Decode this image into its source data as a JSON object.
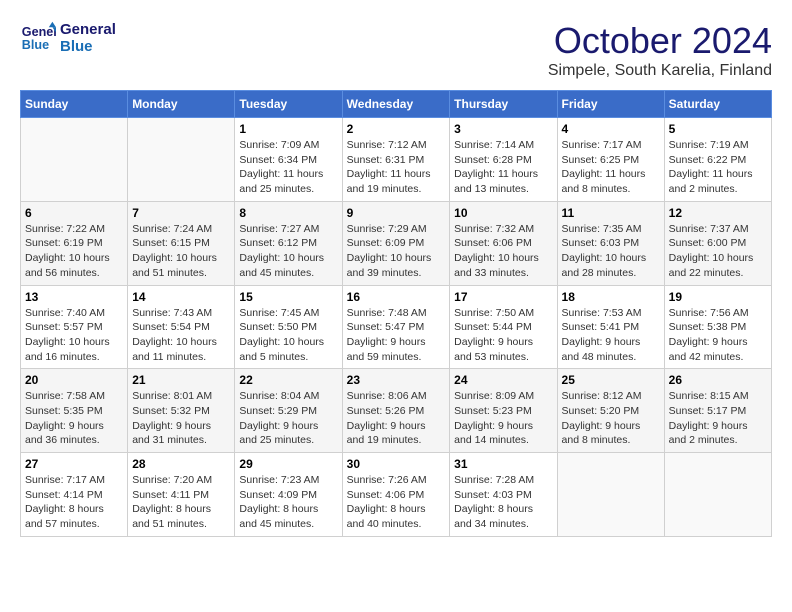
{
  "header": {
    "logo_line1": "General",
    "logo_line2": "Blue",
    "month_title": "October 2024",
    "location": "Simpele, South Karelia, Finland"
  },
  "weekdays": [
    "Sunday",
    "Monday",
    "Tuesday",
    "Wednesday",
    "Thursday",
    "Friday",
    "Saturday"
  ],
  "weeks": [
    [
      {
        "day": "",
        "sunrise": "",
        "sunset": "",
        "daylight": ""
      },
      {
        "day": "",
        "sunrise": "",
        "sunset": "",
        "daylight": ""
      },
      {
        "day": "1",
        "sunrise": "Sunrise: 7:09 AM",
        "sunset": "Sunset: 6:34 PM",
        "daylight": "Daylight: 11 hours and 25 minutes."
      },
      {
        "day": "2",
        "sunrise": "Sunrise: 7:12 AM",
        "sunset": "Sunset: 6:31 PM",
        "daylight": "Daylight: 11 hours and 19 minutes."
      },
      {
        "day": "3",
        "sunrise": "Sunrise: 7:14 AM",
        "sunset": "Sunset: 6:28 PM",
        "daylight": "Daylight: 11 hours and 13 minutes."
      },
      {
        "day": "4",
        "sunrise": "Sunrise: 7:17 AM",
        "sunset": "Sunset: 6:25 PM",
        "daylight": "Daylight: 11 hours and 8 minutes."
      },
      {
        "day": "5",
        "sunrise": "Sunrise: 7:19 AM",
        "sunset": "Sunset: 6:22 PM",
        "daylight": "Daylight: 11 hours and 2 minutes."
      }
    ],
    [
      {
        "day": "6",
        "sunrise": "Sunrise: 7:22 AM",
        "sunset": "Sunset: 6:19 PM",
        "daylight": "Daylight: 10 hours and 56 minutes."
      },
      {
        "day": "7",
        "sunrise": "Sunrise: 7:24 AM",
        "sunset": "Sunset: 6:15 PM",
        "daylight": "Daylight: 10 hours and 51 minutes."
      },
      {
        "day": "8",
        "sunrise": "Sunrise: 7:27 AM",
        "sunset": "Sunset: 6:12 PM",
        "daylight": "Daylight: 10 hours and 45 minutes."
      },
      {
        "day": "9",
        "sunrise": "Sunrise: 7:29 AM",
        "sunset": "Sunset: 6:09 PM",
        "daylight": "Daylight: 10 hours and 39 minutes."
      },
      {
        "day": "10",
        "sunrise": "Sunrise: 7:32 AM",
        "sunset": "Sunset: 6:06 PM",
        "daylight": "Daylight: 10 hours and 33 minutes."
      },
      {
        "day": "11",
        "sunrise": "Sunrise: 7:35 AM",
        "sunset": "Sunset: 6:03 PM",
        "daylight": "Daylight: 10 hours and 28 minutes."
      },
      {
        "day": "12",
        "sunrise": "Sunrise: 7:37 AM",
        "sunset": "Sunset: 6:00 PM",
        "daylight": "Daylight: 10 hours and 22 minutes."
      }
    ],
    [
      {
        "day": "13",
        "sunrise": "Sunrise: 7:40 AM",
        "sunset": "Sunset: 5:57 PM",
        "daylight": "Daylight: 10 hours and 16 minutes."
      },
      {
        "day": "14",
        "sunrise": "Sunrise: 7:43 AM",
        "sunset": "Sunset: 5:54 PM",
        "daylight": "Daylight: 10 hours and 11 minutes."
      },
      {
        "day": "15",
        "sunrise": "Sunrise: 7:45 AM",
        "sunset": "Sunset: 5:50 PM",
        "daylight": "Daylight: 10 hours and 5 minutes."
      },
      {
        "day": "16",
        "sunrise": "Sunrise: 7:48 AM",
        "sunset": "Sunset: 5:47 PM",
        "daylight": "Daylight: 9 hours and 59 minutes."
      },
      {
        "day": "17",
        "sunrise": "Sunrise: 7:50 AM",
        "sunset": "Sunset: 5:44 PM",
        "daylight": "Daylight: 9 hours and 53 minutes."
      },
      {
        "day": "18",
        "sunrise": "Sunrise: 7:53 AM",
        "sunset": "Sunset: 5:41 PM",
        "daylight": "Daylight: 9 hours and 48 minutes."
      },
      {
        "day": "19",
        "sunrise": "Sunrise: 7:56 AM",
        "sunset": "Sunset: 5:38 PM",
        "daylight": "Daylight: 9 hours and 42 minutes."
      }
    ],
    [
      {
        "day": "20",
        "sunrise": "Sunrise: 7:58 AM",
        "sunset": "Sunset: 5:35 PM",
        "daylight": "Daylight: 9 hours and 36 minutes."
      },
      {
        "day": "21",
        "sunrise": "Sunrise: 8:01 AM",
        "sunset": "Sunset: 5:32 PM",
        "daylight": "Daylight: 9 hours and 31 minutes."
      },
      {
        "day": "22",
        "sunrise": "Sunrise: 8:04 AM",
        "sunset": "Sunset: 5:29 PM",
        "daylight": "Daylight: 9 hours and 25 minutes."
      },
      {
        "day": "23",
        "sunrise": "Sunrise: 8:06 AM",
        "sunset": "Sunset: 5:26 PM",
        "daylight": "Daylight: 9 hours and 19 minutes."
      },
      {
        "day": "24",
        "sunrise": "Sunrise: 8:09 AM",
        "sunset": "Sunset: 5:23 PM",
        "daylight": "Daylight: 9 hours and 14 minutes."
      },
      {
        "day": "25",
        "sunrise": "Sunrise: 8:12 AM",
        "sunset": "Sunset: 5:20 PM",
        "daylight": "Daylight: 9 hours and 8 minutes."
      },
      {
        "day": "26",
        "sunrise": "Sunrise: 8:15 AM",
        "sunset": "Sunset: 5:17 PM",
        "daylight": "Daylight: 9 hours and 2 minutes."
      }
    ],
    [
      {
        "day": "27",
        "sunrise": "Sunrise: 7:17 AM",
        "sunset": "Sunset: 4:14 PM",
        "daylight": "Daylight: 8 hours and 57 minutes."
      },
      {
        "day": "28",
        "sunrise": "Sunrise: 7:20 AM",
        "sunset": "Sunset: 4:11 PM",
        "daylight": "Daylight: 8 hours and 51 minutes."
      },
      {
        "day": "29",
        "sunrise": "Sunrise: 7:23 AM",
        "sunset": "Sunset: 4:09 PM",
        "daylight": "Daylight: 8 hours and 45 minutes."
      },
      {
        "day": "30",
        "sunrise": "Sunrise: 7:26 AM",
        "sunset": "Sunset: 4:06 PM",
        "daylight": "Daylight: 8 hours and 40 minutes."
      },
      {
        "day": "31",
        "sunrise": "Sunrise: 7:28 AM",
        "sunset": "Sunset: 4:03 PM",
        "daylight": "Daylight: 8 hours and 34 minutes."
      },
      {
        "day": "",
        "sunrise": "",
        "sunset": "",
        "daylight": ""
      },
      {
        "day": "",
        "sunrise": "",
        "sunset": "",
        "daylight": ""
      }
    ]
  ]
}
